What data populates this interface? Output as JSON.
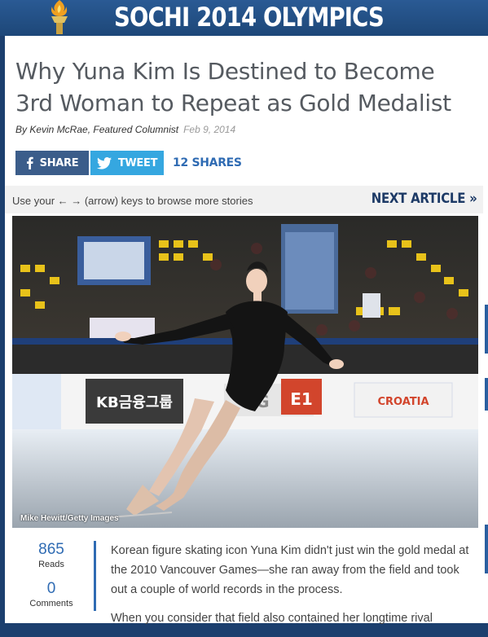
{
  "banner": {
    "title": "SOCHI 2014 OLYMPICS"
  },
  "article": {
    "headline": "Why Yuna Kim Is Destined to Become 3rd Woman to Repeat as Gold Medalist",
    "author": "By Kevin McRae, Featured Columnist",
    "date": "Feb 9, 2014"
  },
  "share": {
    "facebook_label": "SHARE",
    "twitter_label": "TWEET",
    "count_label": "12 SHARES"
  },
  "nav": {
    "hint": "Use your ← → (arrow) keys to browse more stories",
    "next_label": "NEXT ARTICLE »"
  },
  "photo": {
    "credit": "Mike Hewitt/Getty Images",
    "rink_board_text": [
      "KB금융그룹",
      "E1",
      "CROATIA",
      "PG"
    ]
  },
  "stats": {
    "reads_value": "865",
    "reads_label": "Reads",
    "comments_value": "0",
    "comments_label": "Comments"
  },
  "body": {
    "p1": "Korean figure skating icon Yuna Kim didn't just win the gold medal at the 2010 Vancouver Games—she ran away from the field and took out a couple of world records in the process.",
    "p2": "When you consider that field also contained her longtime rival"
  },
  "colors": {
    "banner": "#1d4778",
    "accent": "#2f6bb3",
    "facebook": "#3b5d8a",
    "twitter": "#35a7e0",
    "nav_title": "#1d3a66"
  }
}
